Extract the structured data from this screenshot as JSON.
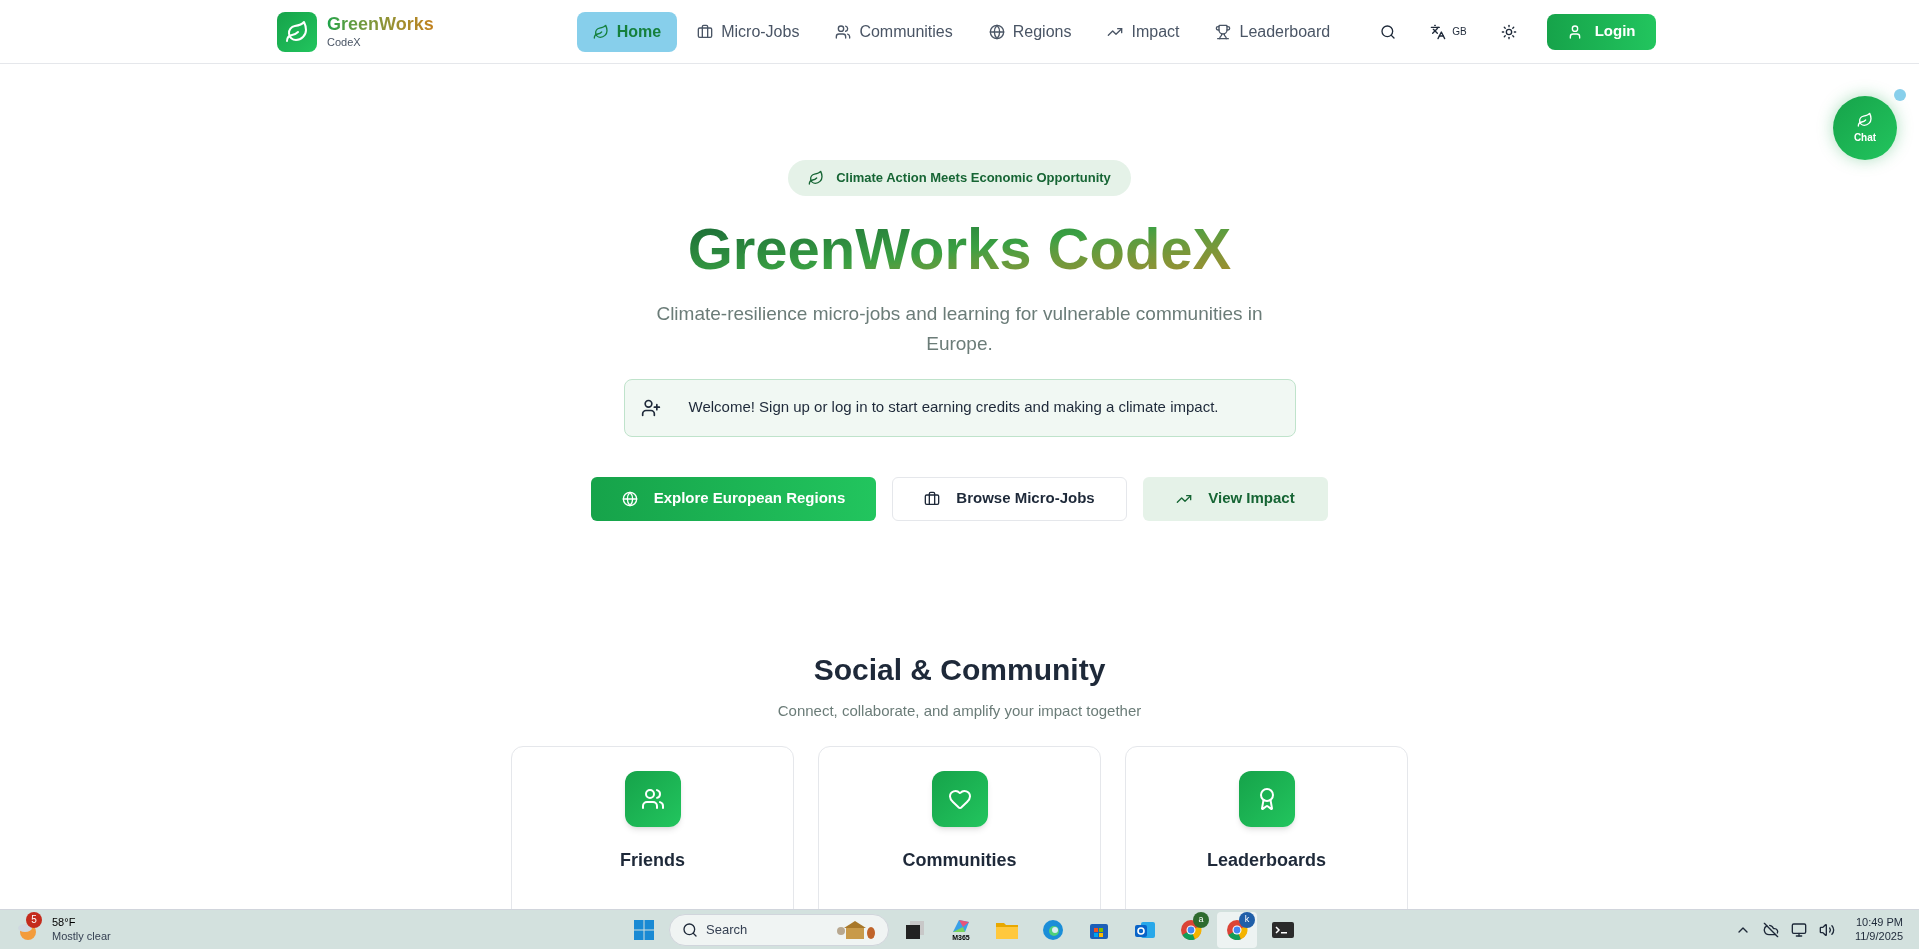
{
  "brand": {
    "name": "GreenWorks",
    "sub": "CodeX"
  },
  "nav": [
    {
      "label": "Home",
      "selected": true
    },
    {
      "label": "Micro-Jobs",
      "selected": false
    },
    {
      "label": "Communities",
      "selected": false
    },
    {
      "label": "Regions",
      "selected": false
    },
    {
      "label": "Impact",
      "selected": false
    },
    {
      "label": "Leaderboard",
      "selected": false
    }
  ],
  "language": "GB",
  "login": "Login",
  "chat": {
    "label": "Chat",
    "unread": true
  },
  "hero": {
    "badge": "Climate Action Meets Economic Opportunity",
    "title": "GreenWorks CodeX",
    "subtitle": "Climate-resilience micro-jobs and learning for vulnerable communities in Europe.",
    "welcome": "Welcome! Sign up or log in to start earning credits and making a climate impact.",
    "actions": [
      {
        "label": "Explore European Regions",
        "kind": "primary"
      },
      {
        "label": "Browse Micro-Jobs",
        "kind": "outline"
      },
      {
        "label": "View Impact",
        "kind": "soft"
      }
    ]
  },
  "social": {
    "title": "Social & Community",
    "subtitle": "Connect, collaborate, and amplify your impact together",
    "cards": [
      {
        "title": "Friends"
      },
      {
        "title": "Communities"
      },
      {
        "title": "Leaderboards"
      }
    ]
  },
  "taskbar": {
    "weather": {
      "badge": "5",
      "temp": "58°F",
      "condition": "Mostly clear"
    },
    "search": "Search",
    "apps": [
      {
        "kind": "files"
      },
      {
        "kind": "m365",
        "label": "M365"
      },
      {
        "kind": "folder"
      },
      {
        "kind": "edge"
      },
      {
        "kind": "store"
      },
      {
        "kind": "outlook"
      },
      {
        "kind": "chrome",
        "badge": "a",
        "selected": false
      },
      {
        "kind": "chrome",
        "badge": "k",
        "selected": true
      },
      {
        "kind": "terminal"
      }
    ],
    "time": "10:49 PM",
    "date": "11/9/2025"
  }
}
